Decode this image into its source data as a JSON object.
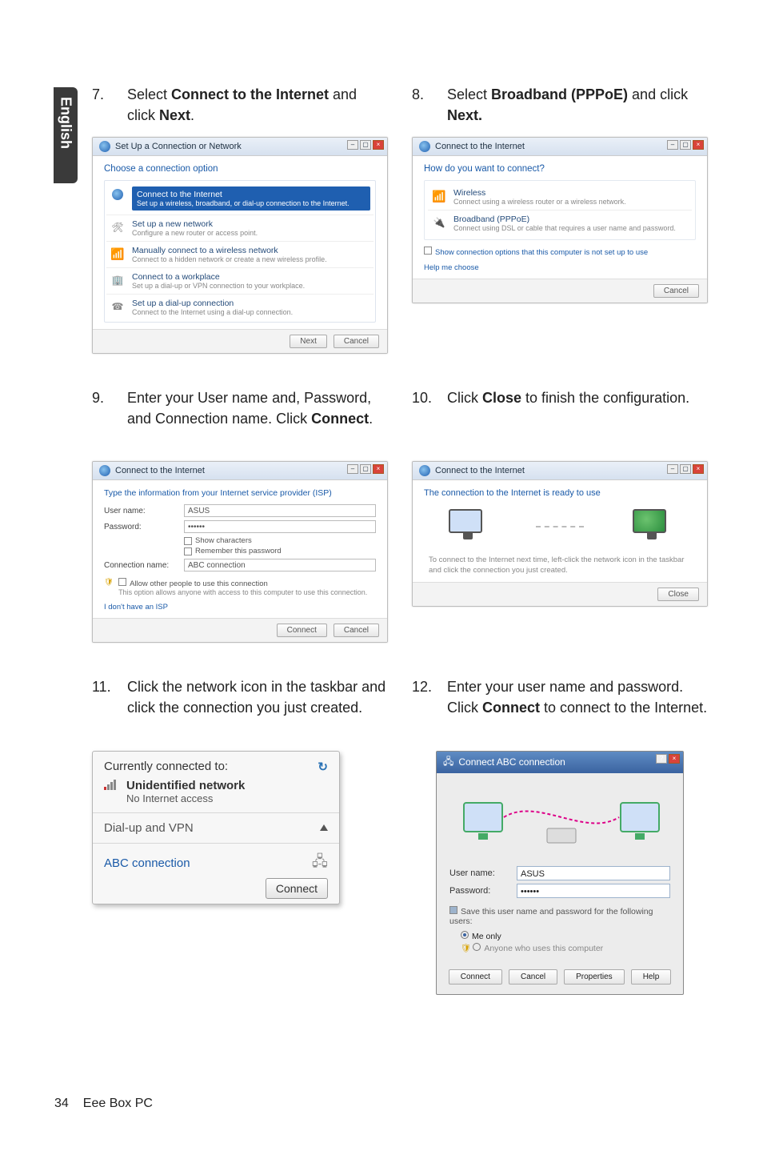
{
  "sideTab": "English",
  "steps": {
    "s7": {
      "num": "7.",
      "text_a": "Select ",
      "bold1": "Connect to the Internet",
      "text_b": " and click ",
      "bold2": "Next",
      "text_c": "."
    },
    "s8": {
      "num": "8.",
      "text_a": "Select ",
      "bold1": "Broadband (PPPoE)",
      "text_b": " and click ",
      "bold2": "Next.",
      "text_c": ""
    },
    "s9": {
      "num": "9.",
      "text": "Enter your User name and, Password, and Connection name. Click ",
      "bold": "Connect",
      "tail": "."
    },
    "s10": {
      "num": "10.",
      "text_a": "Click ",
      "bold": "Close",
      "text_b": " to finish the configuration."
    },
    "s11": {
      "num": "11.",
      "text": "Click the network icon in the taskbar and click the connection you just created."
    },
    "s12": {
      "num": "12.",
      "text_a": "Enter your user name and password. Click ",
      "bold": "Connect",
      "text_b": " to connect to the Internet."
    }
  },
  "win1": {
    "title": "Set Up a Connection or Network",
    "heading": "Choose a connection option",
    "opts": [
      {
        "t": "Connect to the Internet",
        "d": "Set up a wireless, broadband, or dial-up connection to the Internet.",
        "sel": true
      },
      {
        "t": "Set up a new network",
        "d": "Configure a new router or access point."
      },
      {
        "t": "Manually connect to a wireless network",
        "d": "Connect to a hidden network or create a new wireless profile."
      },
      {
        "t": "Connect to a workplace",
        "d": "Set up a dial-up or VPN connection to your workplace."
      },
      {
        "t": "Set up a dial-up connection",
        "d": "Connect to the Internet using a dial-up connection."
      }
    ],
    "btn_next": "Next",
    "btn_cancel": "Cancel"
  },
  "win2": {
    "title": "Connect to the Internet",
    "heading": "How do you want to connect?",
    "opts": [
      {
        "t": "Wireless",
        "d": "Connect using a wireless router or a wireless network."
      },
      {
        "t": "Broadband (PPPoE)",
        "d": "Connect using DSL or cable that requires a user name and password."
      }
    ],
    "help1": "Show connection options that this computer is not set up to use",
    "help2": "Help me choose",
    "btn_cancel": "Cancel"
  },
  "win3": {
    "title": "Connect to the Internet",
    "heading": "Type the information from your Internet service provider (ISP)",
    "rows": {
      "user_label": "User name:",
      "user_value": "ASUS",
      "pass_label": "Password:",
      "pass_value": "••••••",
      "show_chars": "Show characters",
      "remember": "Remember this password",
      "conn_label": "Connection name:",
      "conn_value": "ABC connection"
    },
    "allow": "Allow other people to use this connection",
    "allow_desc": "This option allows anyone with access to this computer to use this connection.",
    "noisp": "I don't have an ISP",
    "btn_connect": "Connect",
    "btn_cancel": "Cancel"
  },
  "win4": {
    "title": "Connect to the Internet",
    "heading": "The connection to the Internet is ready to use",
    "tip": "To connect to the Internet next time, left-click the network icon in the taskbar and click the connection you just created.",
    "btn_close": "Close"
  },
  "flyout": {
    "head": "Currently connected to:",
    "net_name": "Unidentified network",
    "net_sub": "No Internet access",
    "section": "Dial-up and VPN",
    "conn": "ABC connection",
    "btn": "Connect"
  },
  "dlg": {
    "title": "Connect ABC connection",
    "user_label": "User name:",
    "user_value": "ASUS",
    "pass_label": "Password:",
    "pass_value": "••••••",
    "save_note": "Save this user name and password for the following users:",
    "me": "Me only",
    "anyone": "Anyone who uses this computer",
    "btns": {
      "connect": "Connect",
      "cancel": "Cancel",
      "props": "Properties",
      "help": "Help"
    }
  },
  "footer": {
    "page": "34",
    "title": "Eee Box PC"
  }
}
